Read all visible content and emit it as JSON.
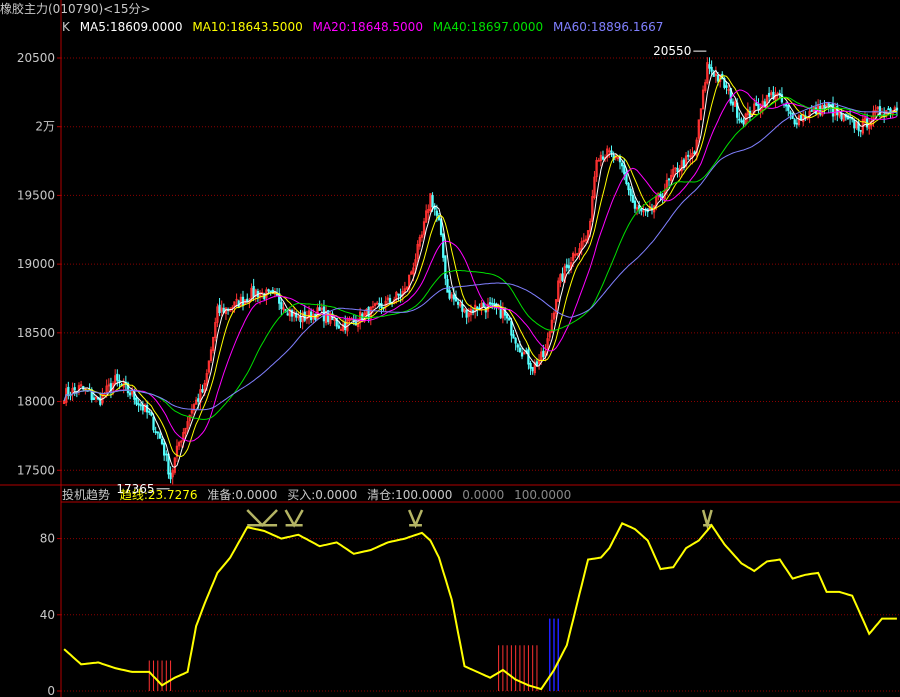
{
  "window_title": "橡胶主力(010790)<15分>",
  "colors": {
    "up": "#ff3232",
    "down": "#54ffff",
    "grid": "#8b0000",
    "frame": "#b00000",
    "axis_text": "#c8c8c8",
    "ma5": "#ffffff",
    "ma10": "#ffff00",
    "ma20": "#ff00ff",
    "ma40": "#00e000",
    "ma60": "#8080ff",
    "trend": "#ffff00",
    "band": "#b4b464"
  },
  "legend": {
    "k_label": "K",
    "ma5": "MA5:18609.0000",
    "ma10": "MA10:18643.5000",
    "ma20": "MA20:18648.5000",
    "ma40": "MA40:18697.0000",
    "ma60": "MA60:18896.1667"
  },
  "indicator_legend": {
    "name": "投机趋势",
    "trend": "趋线:23.7276",
    "prepare": "准备:0.0000",
    "buy": "买入:0.0000",
    "clear": "清仓:100.0000",
    "v1": "0.0000",
    "v2": "100.0000"
  },
  "chart_data": [
    {
      "type": "candlestick",
      "y_ticks": [
        {
          "value": 20500,
          "label": "20500"
        },
        {
          "value": 20000,
          "label": "2万"
        },
        {
          "value": 19500,
          "label": "19500"
        },
        {
          "value": 19000,
          "label": "19000"
        },
        {
          "value": 18500,
          "label": "18500"
        },
        {
          "value": 18000,
          "label": "18000"
        },
        {
          "value": 17500,
          "label": "17500"
        }
      ],
      "ylim": [
        17400,
        20660
      ],
      "price_path": [
        [
          0,
          18050
        ],
        [
          8,
          18100
        ],
        [
          16,
          18000
        ],
        [
          24,
          18150
        ],
        [
          32,
          18050
        ],
        [
          40,
          17900
        ],
        [
          46,
          17700
        ],
        [
          50,
          17450
        ],
        [
          54,
          17700
        ],
        [
          60,
          17950
        ],
        [
          66,
          18100
        ],
        [
          72,
          18650
        ],
        [
          80,
          18700
        ],
        [
          90,
          18800
        ],
        [
          100,
          18750
        ],
        [
          110,
          18600
        ],
        [
          120,
          18650
        ],
        [
          130,
          18550
        ],
        [
          140,
          18620
        ],
        [
          150,
          18700
        ],
        [
          160,
          18800
        ],
        [
          168,
          19200
        ],
        [
          172,
          19500
        ],
        [
          176,
          19300
        ],
        [
          180,
          18800
        ],
        [
          188,
          18650
        ],
        [
          196,
          18700
        ],
        [
          206,
          18650
        ],
        [
          214,
          18400
        ],
        [
          220,
          18250
        ],
        [
          226,
          18350
        ],
        [
          232,
          18850
        ],
        [
          240,
          19100
        ],
        [
          246,
          19200
        ],
        [
          250,
          19800
        ],
        [
          256,
          19800
        ],
        [
          262,
          19700
        ],
        [
          268,
          19400
        ],
        [
          274,
          19350
        ],
        [
          280,
          19500
        ],
        [
          288,
          19700
        ],
        [
          296,
          19800
        ],
        [
          302,
          20450
        ],
        [
          310,
          20300
        ],
        [
          318,
          20050
        ],
        [
          326,
          20150
        ],
        [
          334,
          20250
        ],
        [
          342,
          20050
        ],
        [
          350,
          20100
        ],
        [
          358,
          20150
        ],
        [
          366,
          20050
        ],
        [
          374,
          20000
        ],
        [
          382,
          20100
        ],
        [
          392,
          20150
        ]
      ],
      "candle_count": 392,
      "ma_periods": [
        5,
        10,
        20,
        40,
        60
      ],
      "annotations": [
        {
          "label": "20550",
          "value": 20550,
          "bar": 302
        },
        {
          "label": "17365",
          "value": 17365,
          "bar": 50
        }
      ]
    },
    {
      "type": "line",
      "name": "投机趋势",
      "y_ticks": [
        {
          "value": 80,
          "label": "80"
        },
        {
          "value": 40,
          "label": "40"
        },
        {
          "value": 0,
          "label": "0"
        }
      ],
      "ylim": [
        0,
        95
      ],
      "trend_path": [
        [
          0,
          22
        ],
        [
          8,
          14
        ],
        [
          16,
          15
        ],
        [
          24,
          12
        ],
        [
          32,
          10
        ],
        [
          40,
          10
        ],
        [
          46,
          3
        ],
        [
          52,
          7
        ],
        [
          58,
          10
        ],
        [
          62,
          34
        ],
        [
          66,
          46
        ],
        [
          72,
          62
        ],
        [
          78,
          70
        ],
        [
          86,
          86
        ],
        [
          94,
          84
        ],
        [
          102,
          80
        ],
        [
          110,
          82
        ],
        [
          120,
          76
        ],
        [
          128,
          78
        ],
        [
          136,
          72
        ],
        [
          144,
          74
        ],
        [
          152,
          78
        ],
        [
          160,
          80
        ],
        [
          168,
          83
        ],
        [
          172,
          79
        ],
        [
          176,
          70
        ],
        [
          182,
          48
        ],
        [
          188,
          13
        ],
        [
          194,
          10
        ],
        [
          200,
          7
        ],
        [
          206,
          11
        ],
        [
          212,
          6
        ],
        [
          218,
          3
        ],
        [
          224,
          1
        ],
        [
          230,
          11
        ],
        [
          236,
          24
        ],
        [
          240,
          42
        ],
        [
          246,
          69
        ],
        [
          252,
          70
        ],
        [
          256,
          75
        ],
        [
          262,
          88
        ],
        [
          268,
          85
        ],
        [
          274,
          79
        ],
        [
          280,
          64
        ],
        [
          286,
          65
        ],
        [
          292,
          75
        ],
        [
          298,
          79
        ],
        [
          304,
          87
        ],
        [
          310,
          77
        ],
        [
          318,
          67
        ],
        [
          324,
          63
        ],
        [
          330,
          68
        ],
        [
          336,
          69
        ],
        [
          342,
          59
        ],
        [
          348,
          61
        ],
        [
          354,
          62
        ],
        [
          358,
          52
        ],
        [
          364,
          52
        ],
        [
          370,
          50
        ],
        [
          378,
          30
        ],
        [
          384,
          38
        ],
        [
          392,
          38
        ]
      ],
      "band_value": 95,
      "band_segments": [
        [
          86,
          100
        ],
        [
          104,
          112
        ],
        [
          162,
          168
        ],
        [
          300,
          304
        ]
      ],
      "clear_bars": [
        {
          "from": 40,
          "to": 50,
          "value": 4
        },
        {
          "from": 204,
          "to": 222,
          "value": 6
        }
      ],
      "buy_bars": [
        {
          "from": 228,
          "to": 232,
          "value": 38
        }
      ]
    }
  ]
}
